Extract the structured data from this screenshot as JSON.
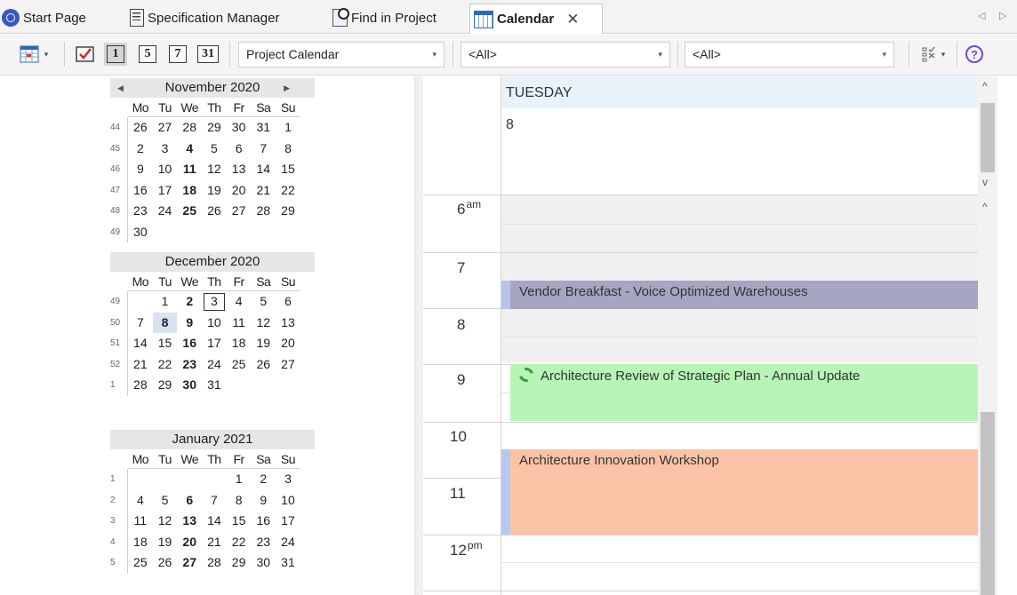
{
  "tabs": [
    {
      "label": "Start Page",
      "icon": "start-page-icon"
    },
    {
      "label": "Specification Manager",
      "icon": "document-list-icon"
    },
    {
      "label": "Find in Project",
      "icon": "find-icon"
    },
    {
      "label": "Calendar",
      "icon": "calendar-icon",
      "active": true,
      "close_glyph": "✕"
    }
  ],
  "tab_scroll": {
    "left": "◁",
    "right": "▷"
  },
  "toolbar": {
    "view_buttons": [
      "1",
      "5",
      "7",
      "31"
    ],
    "calendar_select": "Project Calendar",
    "filter1": "<All>",
    "filter2": "<All>",
    "dropdown_glyph": "▾",
    "help_glyph": "?"
  },
  "mini_calendars": [
    {
      "title": "November 2020",
      "dow": [
        "Mo",
        "Tu",
        "We",
        "Th",
        "Fr",
        "Sa",
        "Su"
      ],
      "weeks": [
        {
          "num": "44",
          "days": [
            "26",
            "27",
            "28",
            "29",
            "30",
            "31",
            "1"
          ]
        },
        {
          "num": "45",
          "days": [
            "2",
            "3",
            "4",
            "5",
            "6",
            "7",
            "8"
          ]
        },
        {
          "num": "46",
          "days": [
            "9",
            "10",
            "11",
            "12",
            "13",
            "14",
            "15"
          ]
        },
        {
          "num": "47",
          "days": [
            "16",
            "17",
            "18",
            "19",
            "20",
            "21",
            "22"
          ]
        },
        {
          "num": "48",
          "days": [
            "23",
            "24",
            "25",
            "26",
            "27",
            "28",
            "29"
          ]
        },
        {
          "num": "49",
          "days": [
            "30",
            "",
            "",
            "",
            "",
            "",
            ""
          ]
        }
      ],
      "nav_prev": "◀",
      "nav_next": "▶"
    },
    {
      "title": "December 2020",
      "dow": [
        "Mo",
        "Tu",
        "We",
        "Th",
        "Fr",
        "Sa",
        "Su"
      ],
      "weeks": [
        {
          "num": "49",
          "days": [
            "",
            "1",
            "2",
            "3",
            "4",
            "5",
            "6"
          ]
        },
        {
          "num": "50",
          "days": [
            "7",
            "8",
            "9",
            "10",
            "11",
            "12",
            "13"
          ]
        },
        {
          "num": "51",
          "days": [
            "14",
            "15",
            "16",
            "17",
            "18",
            "19",
            "20"
          ]
        },
        {
          "num": "52",
          "days": [
            "21",
            "22",
            "23",
            "24",
            "25",
            "26",
            "27"
          ]
        },
        {
          "num": "1",
          "days": [
            "28",
            "29",
            "30",
            "31",
            "",
            "",
            ""
          ]
        }
      ]
    },
    {
      "title": "January 2021",
      "dow": [
        "Mo",
        "Tu",
        "We",
        "Th",
        "Fr",
        "Sa",
        "Su"
      ],
      "weeks": [
        {
          "num": "1",
          "days": [
            "",
            "",
            "",
            "",
            "1",
            "2",
            "3"
          ]
        },
        {
          "num": "2",
          "days": [
            "4",
            "5",
            "6",
            "7",
            "8",
            "9",
            "10"
          ]
        },
        {
          "num": "3",
          "days": [
            "11",
            "12",
            "13",
            "14",
            "15",
            "16",
            "17"
          ]
        },
        {
          "num": "4",
          "days": [
            "18",
            "19",
            "20",
            "21",
            "22",
            "23",
            "24"
          ]
        },
        {
          "num": "5",
          "days": [
            "25",
            "26",
            "27",
            "28",
            "29",
            "30",
            "31"
          ]
        }
      ]
    }
  ],
  "day_view": {
    "weekday": "TUESDAY",
    "date": "8",
    "hours": [
      {
        "label": "6",
        "suffix": "am"
      },
      {
        "label": "7",
        "suffix": ""
      },
      {
        "label": "8",
        "suffix": ""
      },
      {
        "label": "9",
        "suffix": ""
      },
      {
        "label": "10",
        "suffix": ""
      },
      {
        "label": "11",
        "suffix": ""
      },
      {
        "label": "12",
        "suffix": "pm"
      }
    ],
    "events": [
      {
        "title": "Vendor Breakfast - Voice Optimized Warehouses",
        "color": "#a6a6c2"
      },
      {
        "title": "Architecture Review of Strategic Plan - Annual Update",
        "color": "#b6f5b6",
        "recurring": true
      },
      {
        "title": "Architecture Innovation Workshop",
        "color": "#fbc3a6"
      }
    ]
  },
  "scroll_glyphs": {
    "up": "^",
    "down": "v"
  }
}
